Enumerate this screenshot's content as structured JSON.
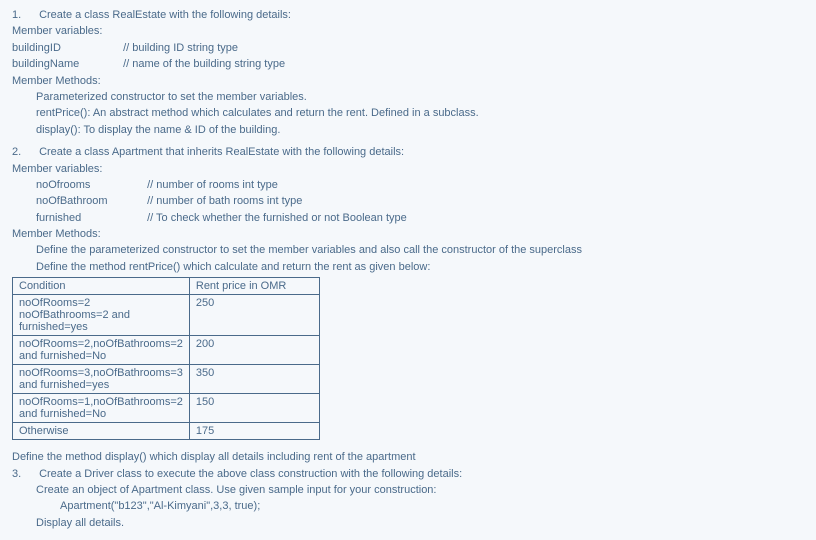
{
  "q1": {
    "num": "1.",
    "title": "Create a class RealEstate with the following details:",
    "memberVarsHeader": "Member variables:",
    "vars": [
      {
        "name": "buildingID",
        "comment": "// building ID string type"
      },
      {
        "name": "buildingName",
        "comment": "// name of the building string type"
      }
    ],
    "memberMethodsHeader": "Member Methods:",
    "methods": [
      "Parameterized constructor to set the member variables.",
      "rentPrice(): An abstract method which calculates and return the rent. Defined in a subclass.",
      "display(): To display the name & ID of the building."
    ]
  },
  "q2": {
    "num": "2.",
    "title": "Create a class Apartment that inherits RealEstate with the following details:",
    "memberVarsHeader": "Member variables:",
    "vars": [
      {
        "name": "noOfrooms",
        "comment": "// number of rooms int type"
      },
      {
        "name": "noOfBathroom",
        "comment": "// number of bath rooms int type"
      },
      {
        "name": "furnished",
        "comment": "// To check whether the furnished or not Boolean type"
      }
    ],
    "memberMethodsHeader": "Member Methods:",
    "methodLines": [
      "Define the parameterized constructor to set the member variables and also call the constructor of the superclass",
      "Define the method rentPrice() which calculate and return the rent as given below:"
    ],
    "table": {
      "headers": [
        "Condition",
        "Rent price in OMR"
      ],
      "rows": [
        [
          "noOfRooms=2\nnoOfBathrooms=2 and furnished=yes",
          "250"
        ],
        [
          "noOfRooms=2,noOfBathrooms=2 and furnished=No",
          "200"
        ],
        [
          "noOfRooms=3,noOfBathrooms=3 and furnished=yes",
          "350"
        ],
        [
          "noOfRooms=1,noOfBathrooms=2 and furnished=No",
          "150"
        ],
        [
          "Otherwise",
          "175"
        ]
      ]
    },
    "afterTable": "Define the method display() which display all details including rent of the apartment"
  },
  "q3": {
    "num": "3.",
    "lines": [
      "Create a Driver class to execute the above class construction with the following details:",
      "Create an object of Apartment class. Use given sample input for your construction:",
      "Apartment(\"b123\",\"Al-Kimyani\",3,3, true);",
      "Display all details."
    ]
  }
}
